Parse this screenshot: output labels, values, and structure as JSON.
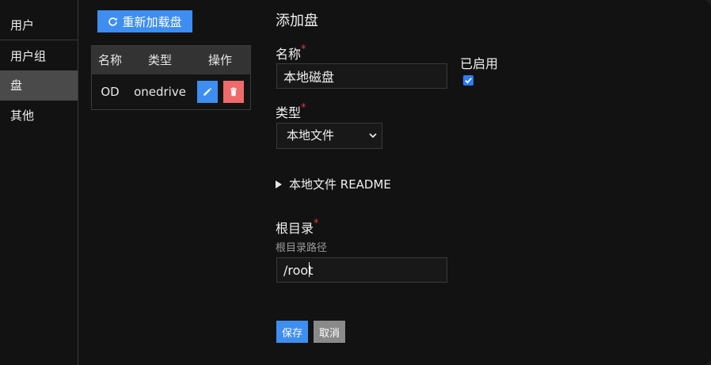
{
  "sidebar": {
    "items": [
      {
        "label": "用户"
      },
      {
        "label": "用户组"
      },
      {
        "label": "盘",
        "active": true
      },
      {
        "label": "其他"
      }
    ]
  },
  "toolbar": {
    "reload_label": "重新加载盘",
    "reload_icon": "refresh-icon"
  },
  "table": {
    "headers": [
      "名称",
      "类型",
      "操作"
    ],
    "rows": [
      {
        "name": "OD",
        "type": "onedrive",
        "actions": [
          "edit-icon",
          "trash-icon"
        ]
      }
    ]
  },
  "form": {
    "title": "添加盘",
    "name_label": "名称",
    "name_value": "本地磁盘",
    "enabled_label": "已启用",
    "enabled_checked": true,
    "type_label": "类型",
    "type_value": "本地文件",
    "readme_label": "本地文件 README",
    "root_label": "根目录",
    "root_hint": "根目录路径",
    "root_value": "/root",
    "required_mark": "*",
    "save_label": "保存",
    "cancel_label": "取消"
  },
  "colors": {
    "primary": "#3d8ef0",
    "danger": "#ef6a6a",
    "neutral": "#8a8a8a",
    "required": "#e53935",
    "background": "#121212"
  }
}
